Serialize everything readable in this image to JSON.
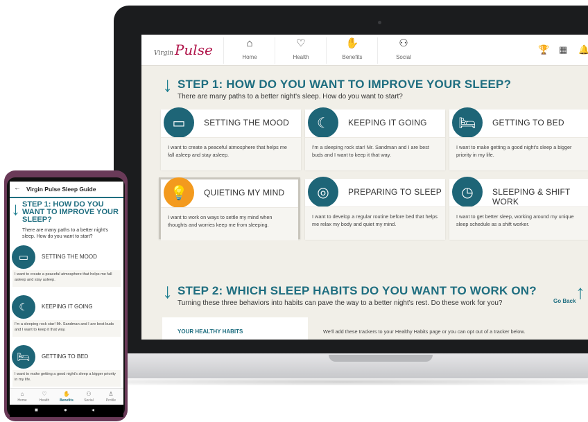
{
  "laptop": {
    "logo_prefix": "Virgin",
    "logo_text": "Pulse",
    "nav": [
      {
        "label": "Home",
        "icon": "⌂"
      },
      {
        "label": "Health",
        "icon": "♡"
      },
      {
        "label": "Benefits",
        "icon": "✋"
      },
      {
        "label": "Social",
        "icon": "⚇"
      }
    ],
    "right_icons": {
      "trophy": "🏆",
      "calendar": "▦",
      "bell": "🔔"
    },
    "step1": {
      "title": "STEP 1: HOW DO YOU WANT TO IMPROVE YOUR SLEEP?",
      "subtitle": "There are many paths to a better night's sleep. How do you want to start?"
    },
    "cards": [
      {
        "title": "SETTING THE MOOD",
        "icon": "▭",
        "text": "I want to create a peaceful atmosphere that helps me fall asleep and stay asleep."
      },
      {
        "title": "KEEPING IT GOING",
        "icon": "☾",
        "text": "I'm a sleeping rock star! Mr. Sandman and I are best buds and I want to keep it that way."
      },
      {
        "title": "GETTING TO BED",
        "icon": "🛏",
        "text": "I want to make getting a good night's sleep a bigger priority in my life."
      },
      {
        "title": "QUIETING MY MIND",
        "icon": "💡",
        "text": "I want to work on ways to settle my mind when thoughts and worries keep me from sleeping."
      },
      {
        "title": "PREPARING TO SLEEP",
        "icon": "◎",
        "text": "I want to develop a regular routine before bed that helps me relax my body and quiet my mind."
      },
      {
        "title": "SLEEPING & SHIFT WORK",
        "icon": "◷",
        "text": "I want to get better sleep, working around my unique sleep schedule as a shift worker."
      }
    ],
    "step2": {
      "title": "STEP 2: WHICH SLEEP HABITS DO YOU WANT TO WORK ON?",
      "subtitle": "Turning these three behaviors into habits can pave the way to a better night's rest. Do these work for you?"
    },
    "go_back": "Go Back",
    "habits_title": "YOUR HEALTHY HABITS",
    "habits_note": "We'll add these trackers to your Healthy Habits page or you can opt out of a tracker below."
  },
  "phone": {
    "header_title": "Virgin Pulse Sleep Guide",
    "step_title": "STEP 1: HOW DO YOU WANT TO IMPROVE YOUR SLEEP?",
    "step_sub": "There are many paths to a better night's sleep. How do you want to start?",
    "cards": [
      {
        "title": "SETTING THE MOOD",
        "icon": "▭",
        "text": "I want to create a peaceful atmosphere that helps me fall asleep and stay asleep."
      },
      {
        "title": "KEEPING IT GOING",
        "icon": "☾",
        "text": "I'm a sleeping rock star! Mr. Sandman and I are best buds and I want to keep it that way."
      },
      {
        "title": "GETTING TO BED",
        "icon": "🛏",
        "text": "I want to make getting a good night's sleep a bigger priority in my life."
      }
    ],
    "tabs": [
      {
        "label": "Home",
        "icon": "⌂"
      },
      {
        "label": "Health",
        "icon": "♡"
      },
      {
        "label": "Benefits",
        "icon": "✋"
      },
      {
        "label": "Social",
        "icon": "⚇"
      },
      {
        "label": "Profile",
        "icon": "♙"
      }
    ],
    "softkeys": {
      "stop": "■",
      "home": "●",
      "back": "◂"
    }
  },
  "colors": {
    "teal": "#1f6e80",
    "orange": "#f39a1e",
    "brand": "#b0144a"
  }
}
